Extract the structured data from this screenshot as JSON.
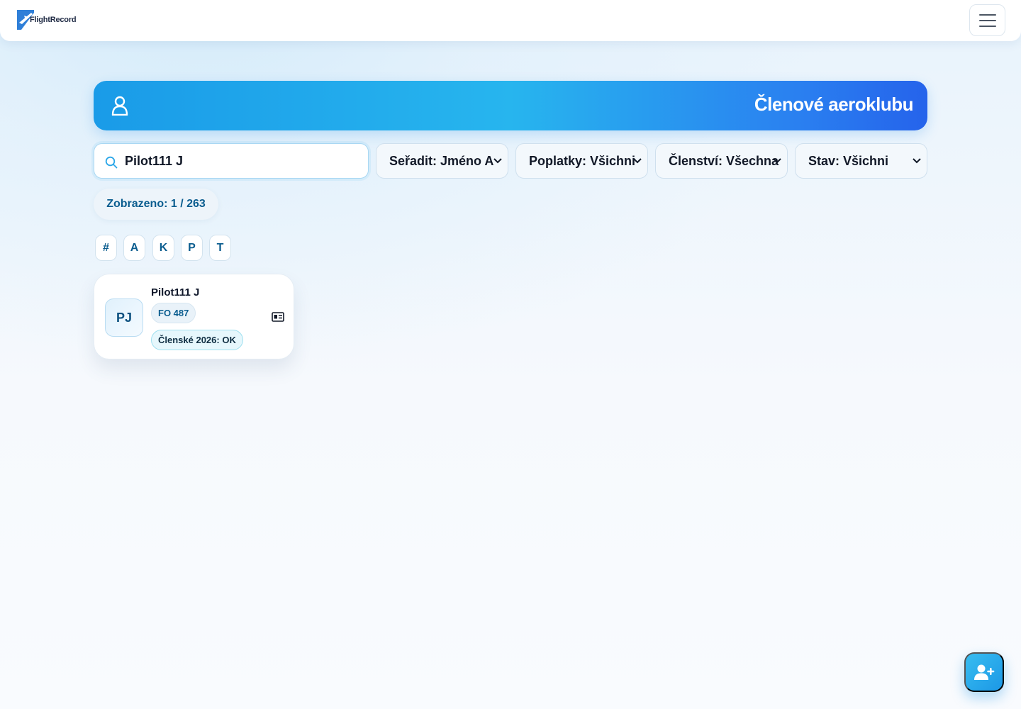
{
  "app": {
    "logo_text": "FlightRecord"
  },
  "hero": {
    "title": "Členové aeroklubu",
    "icon": "user-icon"
  },
  "search": {
    "value": "Pilot111 J",
    "icon": "search-icon"
  },
  "filters": [
    {
      "label": "Seřadit: Jméno A",
      "name": "sort-select"
    },
    {
      "label": "Poplatky: Všichni",
      "name": "fees-select"
    },
    {
      "label": "Členství: Všechna",
      "name": "membership-select"
    },
    {
      "label": "Stav: Všichni",
      "name": "status-select"
    }
  ],
  "summary": {
    "count_label": "Zobrazeno: 1 / 263"
  },
  "letters": [
    "#",
    "A",
    "K",
    "P",
    "T"
  ],
  "members": [
    {
      "initials": "PJ",
      "name": "Pilot111 J",
      "fo_badge": "FO 487",
      "fee_badge": "Členské 2026: OK"
    }
  ],
  "icons": {
    "menu": "hamburger-menu-icon",
    "idcard": "id-card-icon",
    "add_member": "add-user-icon"
  },
  "colors": {
    "accent": "#1a9be8",
    "hero_end": "#2563eb",
    "badge_text": "#0b5d8f"
  }
}
